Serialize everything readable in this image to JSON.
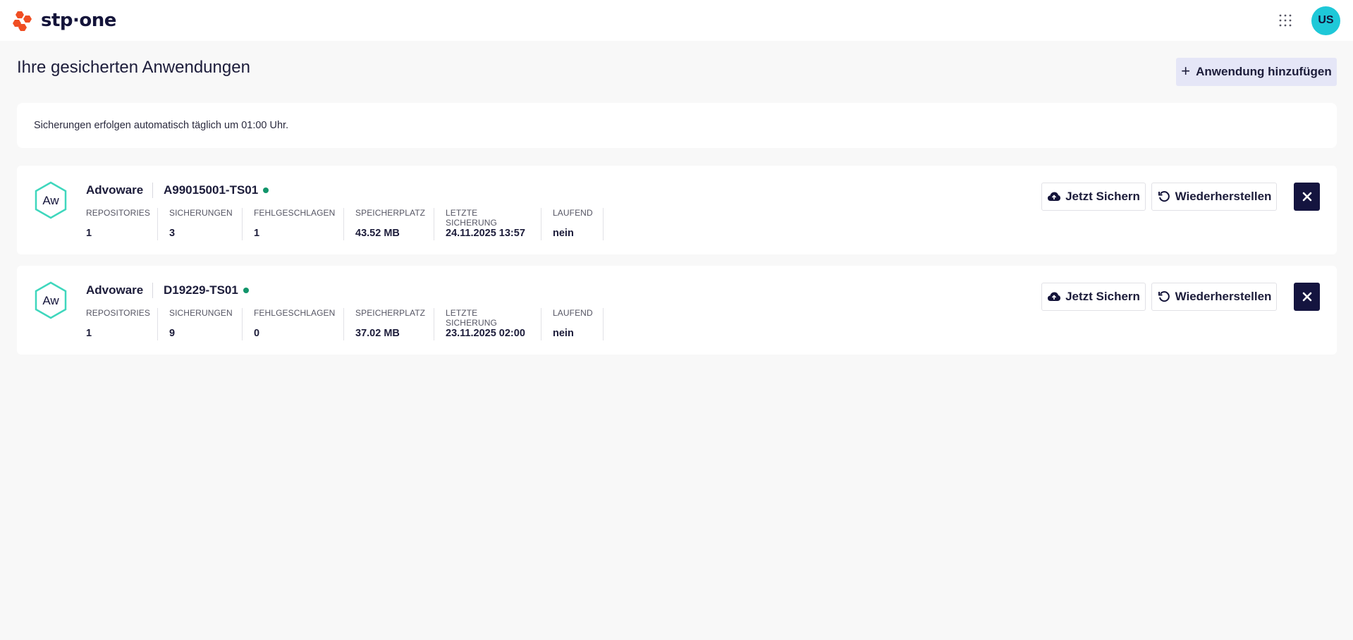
{
  "header": {
    "brand_text": "stp·one",
    "avatar_initials": "US",
    "colors": {
      "brand_orange": "#f04e23",
      "avatar": "#1ec8d8",
      "navy": "#14143f"
    }
  },
  "page": {
    "title": "Ihre gesicherten Anwendungen",
    "add_button_label": "Anwendung hinzufügen",
    "info_text": "Sicherungen erfolgen automatisch täglich um 01:00 Uhr."
  },
  "applications": [
    {
      "icon_text": "Aw",
      "name": "Advoware",
      "host": "A99015001-TS01",
      "status_color": "#12956b",
      "stats": [
        {
          "label": "REPOSITORIES",
          "value": "1"
        },
        {
          "label": "SICHERUNGEN",
          "value": "3"
        },
        {
          "label": "FEHLGESCHLAGEN",
          "value": "1"
        },
        {
          "label": "SPEICHERPLATZ",
          "value": "43.52 MB"
        },
        {
          "label": "LETZTE SICHERUNG",
          "value": "24.11.2025 13:57"
        },
        {
          "label": "LAUFEND",
          "value": "nein"
        }
      ],
      "backup_label": "Jetzt Sichern",
      "restore_label": "Wiederherstellen"
    },
    {
      "icon_text": "Aw",
      "name": "Advoware",
      "host": "D19229-TS01",
      "status_color": "#12956b",
      "stats": [
        {
          "label": "REPOSITORIES",
          "value": "1"
        },
        {
          "label": "SICHERUNGEN",
          "value": "9"
        },
        {
          "label": "FEHLGESCHLAGEN",
          "value": "0"
        },
        {
          "label": "SPEICHERPLATZ",
          "value": "37.02 MB"
        },
        {
          "label": "LETZTE SICHERUNG",
          "value": "23.11.2025 02:00"
        },
        {
          "label": "LAUFEND",
          "value": "nein"
        }
      ],
      "backup_label": "Jetzt Sichern",
      "restore_label": "Wiederherstellen"
    }
  ]
}
